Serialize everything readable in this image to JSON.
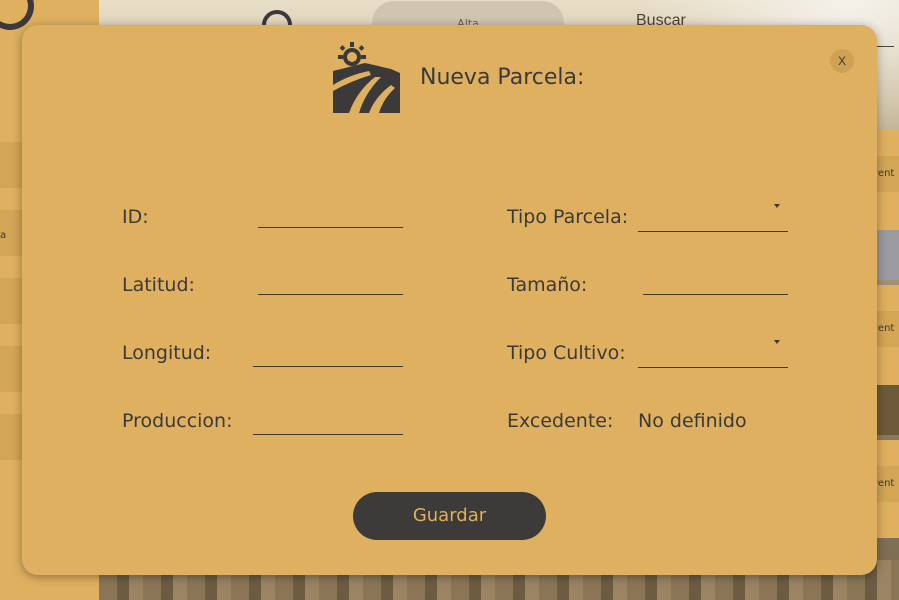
{
  "background": {
    "top_pill_text": "Alta",
    "search_label": "Buscar",
    "sidebar_text": "a",
    "right_card_text": "vent"
  },
  "dialog": {
    "title": "Nueva Parcela:",
    "close_label": "X",
    "fields": {
      "id": {
        "label": "ID:",
        "value": ""
      },
      "latitud": {
        "label": "Latitud:",
        "value": ""
      },
      "longitud": {
        "label": "Longitud:",
        "value": ""
      },
      "produccion": {
        "label": "Produccion:",
        "value": ""
      },
      "tipo_parcela": {
        "label": "Tipo Parcela:",
        "value": ""
      },
      "tamano": {
        "label": "Tamaño:",
        "value": ""
      },
      "tipo_cultivo": {
        "label": "Tipo Cultivo:",
        "value": ""
      },
      "excedente": {
        "label": "Excedente:",
        "value": "No definido"
      }
    },
    "save_label": "Guardar"
  },
  "colors": {
    "accent": "#dfb060",
    "dark": "#3b3a38"
  },
  "icons": {
    "logo": "farm-field-sun-icon",
    "close": "close-icon",
    "dropdown": "chevron-down-icon"
  }
}
